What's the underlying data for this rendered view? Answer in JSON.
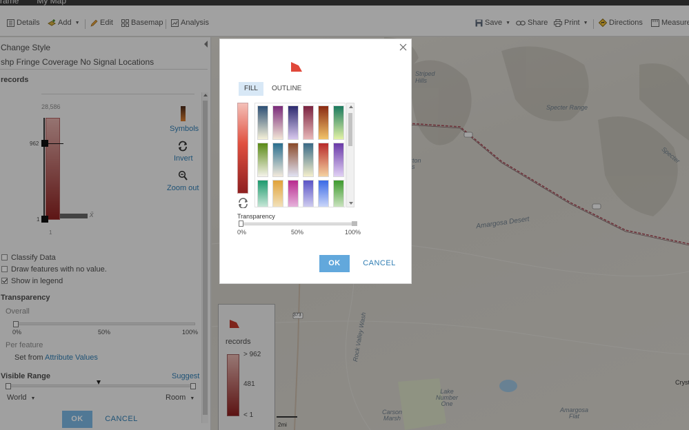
{
  "app": {
    "header_left": "rame",
    "header_title": "My Map"
  },
  "toolbar": {
    "details": "Details",
    "add": "Add",
    "edit": "Edit",
    "basemap": "Basemap",
    "analysis": "Analysis",
    "save": "Save",
    "share": "Share",
    "print": "Print",
    "directions": "Directions",
    "measure": "Measure"
  },
  "panel": {
    "heading": "Change Style",
    "layer_name": "shp Fringe Coverage No Signal Locations",
    "field": "records",
    "slider_max": "28,586",
    "slider_handle_top": "962",
    "slider_handle_bottom": "1",
    "slider_min": "1",
    "mean_symbol": "x̄",
    "symbols": "Symbols",
    "invert": "Invert",
    "zoom_out": "Zoom out",
    "classify": "Classify Data",
    "draw_no_value": "Draw features with no value.",
    "show_legend": "Show in legend",
    "show_legend_checked": true,
    "transparency_title": "Transparency",
    "overall": "Overall",
    "overall_ticks": [
      "0%",
      "50%",
      "100%"
    ],
    "per_feature": "Per feature",
    "set_from": "Set from",
    "attribute_values": "Attribute Values",
    "visible_range": "Visible Range",
    "suggest": "Suggest",
    "range_min": "World",
    "range_max": "Room",
    "ok": "OK",
    "cancel": "CANCEL"
  },
  "map": {
    "labels": {
      "striped_hills": "Striped\nHills",
      "specter_range": "Specter Range",
      "specter_right": "Specter",
      "amargosa_desert": "Amargosa Desert",
      "rock_valley_wash": "Rock Valley Wash",
      "lake_number_one": "Lake\nNumber\nOne",
      "carson_marsh": "Carson\nMarsh",
      "amargosa_flat": "Amargosa\nFlat",
      "road_373": "373",
      "fragment_rton": "rton\nls",
      "fragment_cryst": "Cryst",
      "scale": "2mi"
    },
    "colors": {
      "terrain": "#d7d4cc",
      "road": "#a54a55",
      "water": "#9fc4e0",
      "park": "#d9e2c4"
    }
  },
  "legend": {
    "field": "records",
    "high": "> 962",
    "mid": "481",
    "low": "< 1"
  },
  "dialog": {
    "tab_fill": "FILL",
    "tab_outline": "OUTLINE",
    "transparency": "Transparency",
    "ticks": [
      "0%",
      "50%",
      "100%"
    ],
    "transparency_value": 0,
    "ok": "OK",
    "cancel": "CANCEL",
    "accent": "#e0483a",
    "ramps": [
      [
        "#2c4f74",
        "#f4f0d8"
      ],
      [
        "#7a2a7a",
        "#f2e6d6"
      ],
      [
        "#2c2a6e",
        "#d8c8ee"
      ],
      [
        "#7a2340",
        "#e8b8b8"
      ],
      [
        "#8a2a12",
        "#f2c46a"
      ],
      [
        "#1b7a5e",
        "#e2f2a6"
      ],
      [
        "#5a8a16",
        "#f4f2e8"
      ],
      [
        "#2a6e8e",
        "#f2eadc"
      ],
      [
        "#8a4a2a",
        "#e0e2f2"
      ],
      [
        "#3a6a86",
        "#f4efcc"
      ],
      [
        "#b82a2a",
        "#f4d2a0"
      ],
      [
        "#6a3aa8",
        "#e0d0f4"
      ],
      [
        "#1e9a6e",
        "#f2faf2"
      ],
      [
        "#e0a23a",
        "#f7f2dc"
      ],
      [
        "#b82a8e",
        "#f2d6f0"
      ],
      [
        "#5a54c6",
        "#eeecfa"
      ],
      [
        "#3a6ae6",
        "#f0f2fe"
      ],
      [
        "#3e9a2e",
        "#eef6e4"
      ]
    ]
  }
}
